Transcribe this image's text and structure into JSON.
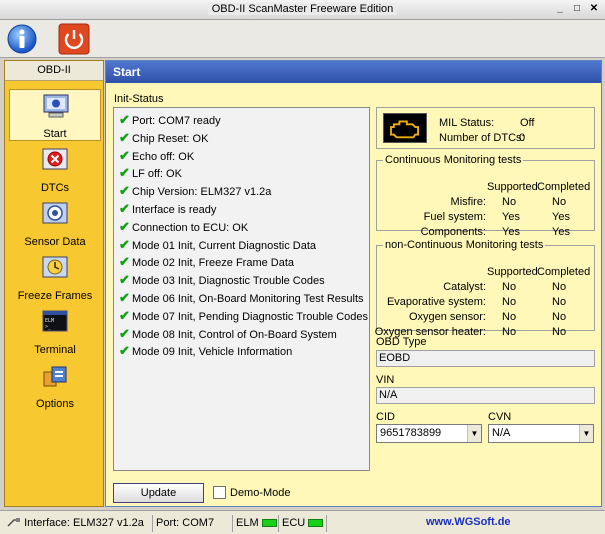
{
  "window": {
    "title": "OBD-II ScanMaster Freeware Edition"
  },
  "nav": {
    "header": "OBD-II",
    "items": [
      {
        "id": "start",
        "label": "Start",
        "icon": "computer-icon"
      },
      {
        "id": "dtcs",
        "label": "DTCs",
        "icon": "error-icon"
      },
      {
        "id": "sensor",
        "label": "Sensor Data",
        "icon": "gauge-icon"
      },
      {
        "id": "freeze",
        "label": "Freeze Frames",
        "icon": "clock-icon"
      },
      {
        "id": "terminal",
        "label": "Terminal",
        "icon": "terminal-icon"
      },
      {
        "id": "options",
        "label": "Options",
        "icon": "options-icon"
      }
    ]
  },
  "main": {
    "title": "Start",
    "init_label": "Init-Status",
    "init_items": [
      "Port: COM7 ready",
      "Chip Reset: OK",
      "Echo off: OK",
      "LF off: OK",
      "Chip Version: ELM327 v1.2a",
      "Interface is ready",
      "Connection to ECU: OK",
      "Mode 01 Init, Current Diagnostic Data",
      "Mode 02 Init, Freeze Frame Data",
      "Mode 03 Init, Diagnostic Trouble Codes",
      "Mode 06 Init, On-Board Monitoring Test Results",
      "Mode 07 Init, Pending Diagnostic Trouble Codes",
      "Mode 08 Init, Control of On-Board System",
      "Mode 09 Init, Vehicle Information"
    ],
    "mil": {
      "status_label": "MIL Status:",
      "status_value": "Off",
      "dtc_label": "Number of DTCs:",
      "dtc_value": "0"
    },
    "continuous": {
      "title": "Continuous Monitoring tests",
      "supported_hdr": "Supported",
      "completed_hdr": "Completed",
      "rows": [
        {
          "label": "Misfire:",
          "supported": "No",
          "completed": "No"
        },
        {
          "label": "Fuel system:",
          "supported": "Yes",
          "completed": "Yes"
        },
        {
          "label": "Components:",
          "supported": "Yes",
          "completed": "Yes"
        }
      ]
    },
    "noncontinuous": {
      "title": "non-Continuous Monitoring tests",
      "supported_hdr": "Supported",
      "completed_hdr": "Completed",
      "rows": [
        {
          "label": "Catalyst:",
          "supported": "No",
          "completed": "No"
        },
        {
          "label": "Evaporative system:",
          "supported": "No",
          "completed": "No"
        },
        {
          "label": "Oxygen sensor:",
          "supported": "No",
          "completed": "No"
        },
        {
          "label": "Oxygen sensor heater:",
          "supported": "No",
          "completed": "No"
        }
      ]
    },
    "obd_type": {
      "label": "OBD Type",
      "value": "EOBD"
    },
    "vin": {
      "label": "VIN",
      "value": "N/A"
    },
    "cid": {
      "label": "CID",
      "value": "9651783899"
    },
    "cvn": {
      "label": "CVN",
      "value": "N/A"
    },
    "update_label": "Update",
    "demo_label": "Demo-Mode"
  },
  "status": {
    "interface": "Interface: ELM327 v1.2a",
    "port": "Port: COM7",
    "elm": "ELM",
    "ecu": "ECU",
    "website": "www.WGSoft.de"
  }
}
